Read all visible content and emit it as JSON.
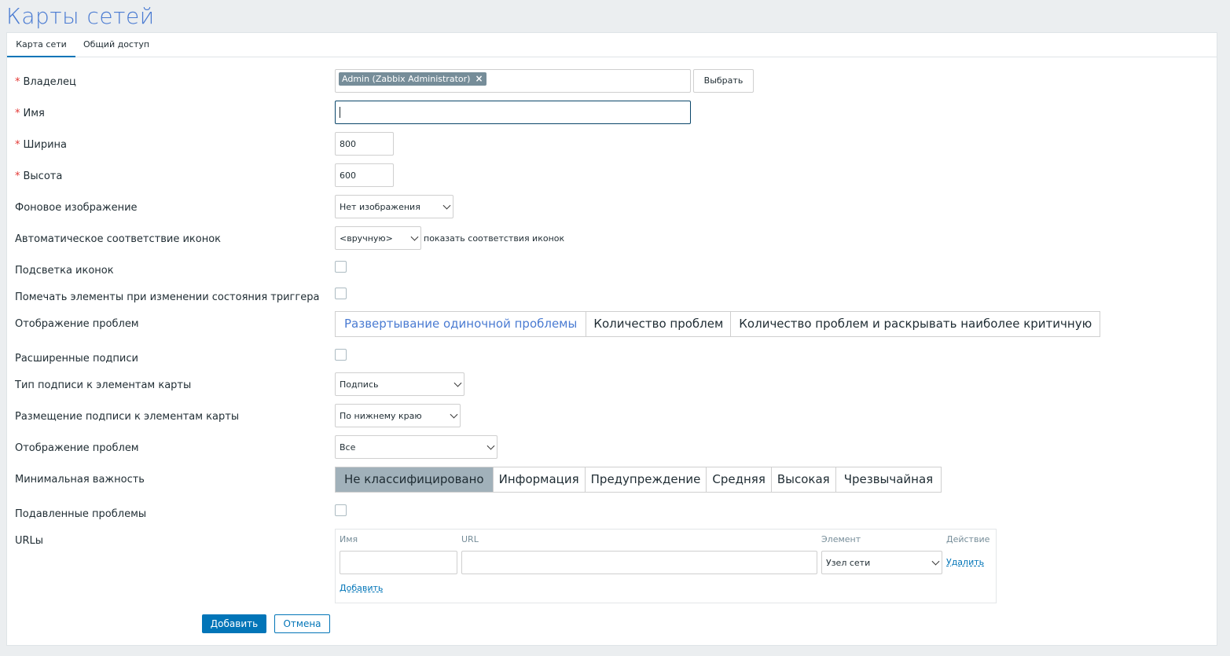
{
  "page": {
    "title": "Карты сетей"
  },
  "tabs": [
    {
      "label": "Карта сети"
    },
    {
      "label": "Общий доступ"
    }
  ],
  "form": {
    "owner": {
      "label": "Владелец",
      "chip": "Admin (Zabbix Administrator)",
      "chip_remove": "×",
      "select_button": "Выбрать"
    },
    "name": {
      "label": "Имя",
      "value": ""
    },
    "width": {
      "label": "Ширина",
      "value": "800"
    },
    "height": {
      "label": "Высота",
      "value": "600"
    },
    "background": {
      "label": "Фоновое изображение",
      "value": "Нет изображения"
    },
    "iconmap": {
      "label": "Автоматическое соответствие иконок",
      "value": "<вручную>",
      "link": "показать соответствия иконок"
    },
    "highlight": {
      "label": "Подсветка иконок",
      "checked": false
    },
    "markelements": {
      "label": "Помечать элементы при изменении состояния триггера",
      "checked": false
    },
    "problem_display": {
      "label": "Отображение проблем",
      "options": [
        "Развертывание одиночной проблемы",
        "Количество проблем",
        "Количество проблем и раскрывать наиболее критичную"
      ],
      "selected": "Развертывание одиночной проблемы"
    },
    "expand_labels": {
      "label": "Расширенные подписи",
      "checked": false
    },
    "label_type": {
      "label": "Тип подписи к элементам карты",
      "value": "Подпись"
    },
    "label_location": {
      "label": "Размещение подписи к элементам карты",
      "value": "По нижнему краю"
    },
    "show_problems": {
      "label": "Отображение проблем",
      "value": "Все"
    },
    "severity": {
      "label": "Минимальная важность",
      "options": [
        "Не классифицировано",
        "Информация",
        "Предупреждение",
        "Средняя",
        "Высокая",
        "Чрезвычайная"
      ],
      "selected": "Не классифицировано"
    },
    "suppressed": {
      "label": "Подавленные проблемы",
      "checked": false
    },
    "urls": {
      "label": "URLы",
      "columns": {
        "name": "Имя",
        "url": "URL",
        "element": "Элемент",
        "action": "Действие"
      },
      "rows": [
        {
          "name": "",
          "url": "",
          "element": "Узел сети",
          "action": "Удалить"
        }
      ],
      "add_link": "Добавить"
    }
  },
  "buttons": {
    "submit": "Добавить",
    "cancel": "Отмена"
  },
  "colors": {
    "accent": "#0275b8",
    "title": "#4a7bd2",
    "required": "#e33734",
    "selected_segment": "#a1b1ba"
  }
}
